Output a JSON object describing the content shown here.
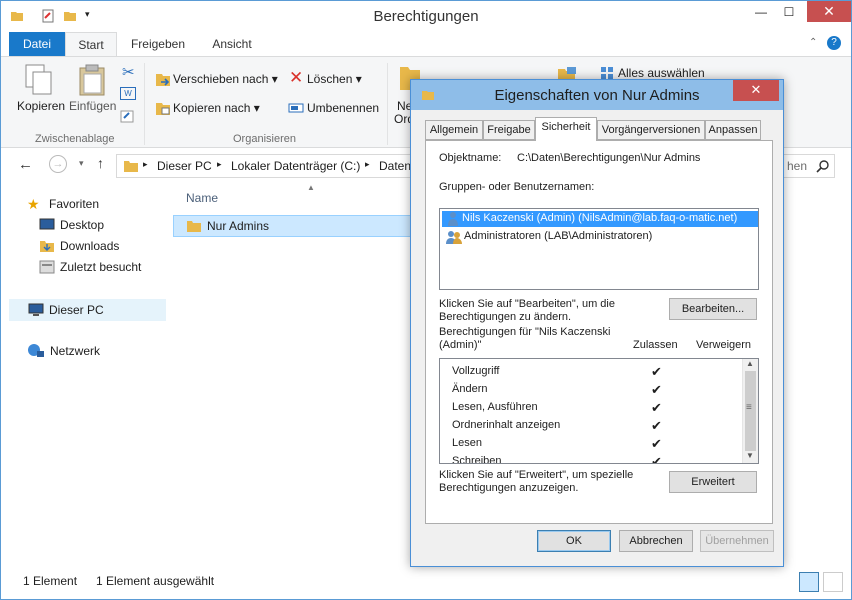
{
  "window": {
    "title": "Berechtigungen"
  },
  "ribbon": {
    "tabs": [
      "Datei",
      "Start",
      "Freigeben",
      "Ansicht"
    ],
    "clipboard": {
      "copy": "Kopieren",
      "paste": "Einfügen",
      "group": "Zwischenablage"
    },
    "organize": {
      "move": "Verschieben nach",
      "copy_to": "Kopieren nach",
      "delete": "Löschen",
      "rename": "Umbenennen",
      "group": "Organisieren"
    },
    "new_partial": [
      "Ne",
      "Ord"
    ],
    "select_all": "Alles auswählen"
  },
  "address": {
    "crumbs": [
      "Dieser PC",
      "Lokaler Datenträger (C:)",
      "Daten"
    ],
    "search_partial": "hen"
  },
  "nav": {
    "favorites": "Favoriten",
    "desktop": "Desktop",
    "downloads": "Downloads",
    "recent": "Zuletzt besucht",
    "this_pc": "Dieser PC",
    "network": "Netzwerk"
  },
  "filelist": {
    "col_name": "Name",
    "items": [
      "Nur Admins"
    ]
  },
  "status": {
    "count": "1 Element",
    "selected": "1 Element ausgewählt"
  },
  "dialog": {
    "title": "Eigenschaften von Nur Admins",
    "tabs": [
      "Allgemein",
      "Freigabe",
      "Sicherheit",
      "Vorgängerversionen",
      "Anpassen"
    ],
    "object_label": "Objektname:",
    "object_value": "C:\\Daten\\Berechtigungen\\Nur Admins",
    "groups_label": "Gruppen- oder Benutzernamen:",
    "groups": [
      "Nils Kaczenski (Admin) (NilsAdmin@lab.faq-o-matic.net)",
      "Administratoren (LAB\\Administratoren)"
    ],
    "edit_hint_1": "Klicken Sie auf \"Bearbeiten\", um die",
    "edit_hint_2": "Berechtigungen zu ändern.",
    "edit_button": "Bearbeiten...",
    "perms_for_1": "Berechtigungen für \"Nils Kaczenski",
    "perms_for_2": "(Admin)\"",
    "col_allow": "Zulassen",
    "col_deny": "Verweigern",
    "permissions": [
      "Vollzugriff",
      "Ändern",
      "Lesen, Ausführen",
      "Ordnerinhalt anzeigen",
      "Lesen",
      "Schreiben"
    ],
    "check_mark": "✔",
    "adv_hint_1": "Klicken Sie auf \"Erweitert\", um spezielle",
    "adv_hint_2": "Berechtigungen anzuzeigen.",
    "advanced_button": "Erweitert",
    "ok": "OK",
    "cancel": "Abbrechen",
    "apply": "Übernehmen"
  }
}
